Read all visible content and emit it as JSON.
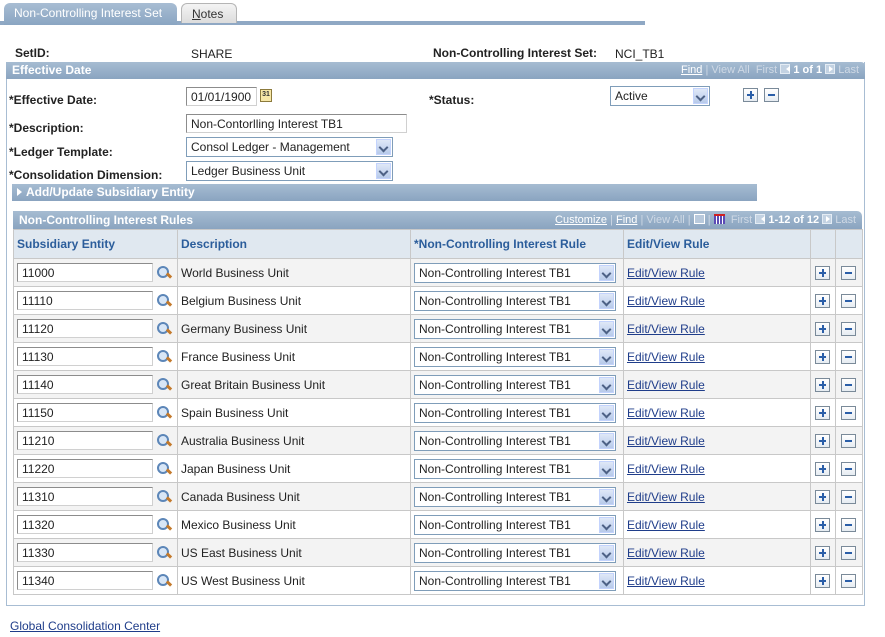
{
  "tabs": [
    {
      "label": "Non-Controlling Interest Set",
      "active": true
    },
    {
      "label_prefix": "N",
      "label_rest": "otes",
      "active": false
    }
  ],
  "header": {
    "setid_label": "SetID:",
    "setid_value": "SHARE",
    "nci_set_label": "Non-Controlling Interest Set:",
    "nci_set_value": "NCI_TB1"
  },
  "effective_date_section": {
    "title": "Effective Date",
    "nav": {
      "find": "Find",
      "sep": "|",
      "view_all": "View All",
      "first": "First",
      "count": "1 of 1",
      "last": "Last"
    },
    "effective_date_label": "*Effective Date:",
    "effective_date_value": "01/01/1900",
    "calendar_icon_text": "31",
    "status_label": "*Status:",
    "status_value": "Active",
    "description_label": "*Description:",
    "description_value": "Non-Contorlling Interest TB1",
    "ledger_template_label": "*Ledger Template:",
    "ledger_template_value": "Consol Ledger - Management",
    "consolidation_dimension_label": "*Consolidation Dimension:",
    "consolidation_dimension_value": "Ledger Business Unit",
    "add_update_label": "Add/Update Subsidiary Entity"
  },
  "rules_grid": {
    "title": "Non-Controlling Interest Rules",
    "nav": {
      "customize": "Customize",
      "sep": "|",
      "find": "Find",
      "view_all": "View All",
      "first": "First",
      "count": "1-12 of 12",
      "last": "Last"
    },
    "columns": [
      "Subsidiary Entity",
      "Description",
      "*Non-Controlling Interest Rule",
      "Edit/View Rule"
    ],
    "rows": [
      {
        "entity": "11000",
        "description": "World Business Unit",
        "rule": "Non-Controlling Interest TB1",
        "link": "Edit/View Rule"
      },
      {
        "entity": "11110",
        "description": "Belgium Business Unit",
        "rule": "Non-Controlling Interest TB1",
        "link": "Edit/View Rule"
      },
      {
        "entity": "11120",
        "description": "Germany Business Unit",
        "rule": "Non-Controlling Interest TB1",
        "link": "Edit/View Rule"
      },
      {
        "entity": "11130",
        "description": "France Business Unit",
        "rule": "Non-Controlling Interest TB1",
        "link": "Edit/View Rule"
      },
      {
        "entity": "11140",
        "description": "Great Britain Business Unit",
        "rule": "Non-Controlling Interest TB1",
        "link": "Edit/View Rule"
      },
      {
        "entity": "11150",
        "description": "Spain Business Unit",
        "rule": "Non-Controlling Interest TB1",
        "link": "Edit/View Rule"
      },
      {
        "entity": "11210",
        "description": "Australia Business Unit",
        "rule": "Non-Controlling Interest TB1",
        "link": "Edit/View Rule"
      },
      {
        "entity": "11220",
        "description": "Japan Business Unit",
        "rule": "Non-Controlling Interest TB1",
        "link": "Edit/View Rule"
      },
      {
        "entity": "11310",
        "description": "Canada Business Unit",
        "rule": "Non-Controlling Interest TB1",
        "link": "Edit/View Rule"
      },
      {
        "entity": "11320",
        "description": "Mexico Business Unit",
        "rule": "Non-Controlling Interest TB1",
        "link": "Edit/View Rule"
      },
      {
        "entity": "11330",
        "description": "US East Business Unit",
        "rule": "Non-Controlling Interest TB1",
        "link": "Edit/View Rule"
      },
      {
        "entity": "11340",
        "description": "US West Business Unit",
        "rule": "Non-Controlling Interest TB1",
        "link": "Edit/View Rule"
      }
    ]
  },
  "footer": {
    "link": "Global Consolidation Center"
  },
  "colors": {
    "header_bar": "#8aa4c0",
    "column_header_text": "#2b5d9b",
    "link": "#1f3d8a",
    "row_alt": "#f3f3f3"
  }
}
